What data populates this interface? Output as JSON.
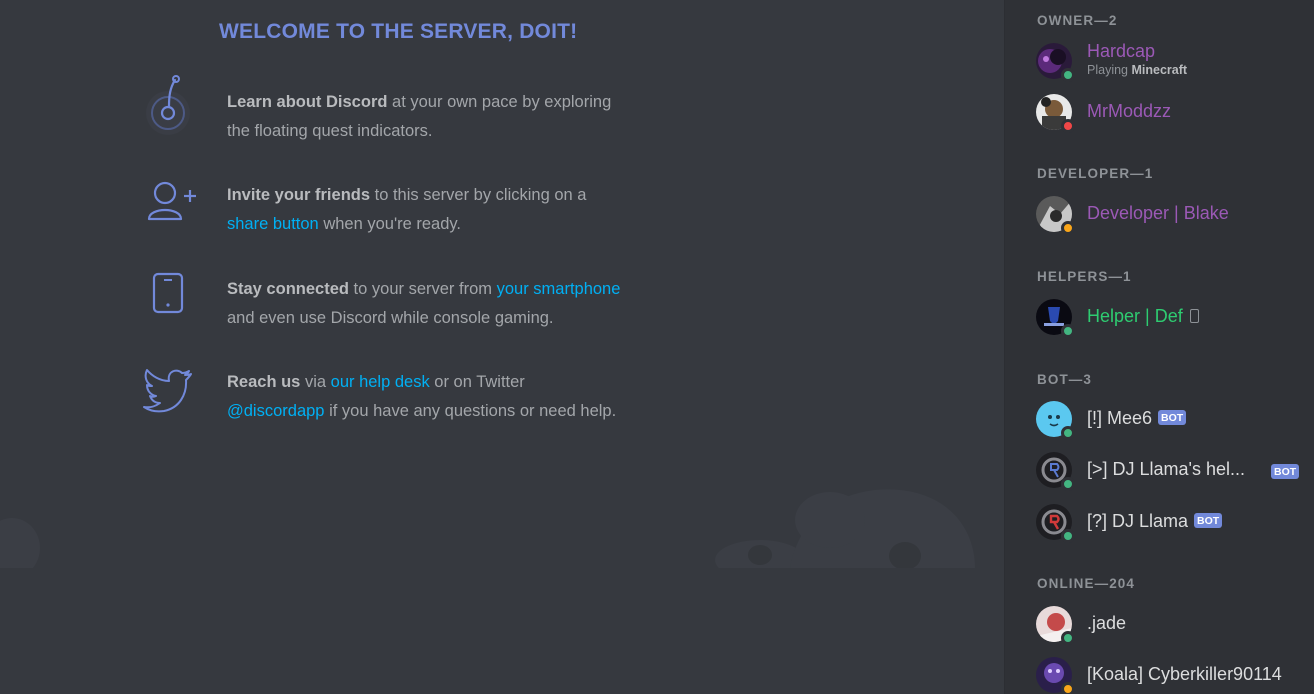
{
  "welcome": {
    "title": "WELCOME TO THE SERVER, DOIT!",
    "items": [
      {
        "icon": "quest-indicator-icon",
        "bold": "Learn about Discord",
        "t1": " at your own pace by exploring",
        "line2": "the floating quest indicators."
      },
      {
        "icon": "add-friend-icon",
        "bold": "Invite your friends",
        "t1": " to this server by clicking on a",
        "link": "share button",
        "t2": " when you're ready."
      },
      {
        "icon": "smartphone-icon",
        "bold": "Stay connected",
        "t1": " to your server from ",
        "link": "your smartphone",
        "line2": "and even use Discord while console gaming."
      },
      {
        "icon": "twitter-bird-icon",
        "bold": "Reach us",
        "t1": " via ",
        "link": "our help desk",
        "t2": " or on Twitter",
        "link2": "@discordapp",
        "t3": " if you have any questions or need help."
      }
    ]
  },
  "members": {
    "groups": [
      {
        "label": "OWNER—2"
      },
      {
        "label": "DEVELOPER—1"
      },
      {
        "label": "HELPERS—1"
      },
      {
        "label": "BOT—3"
      },
      {
        "label": "ONLINE—204"
      }
    ],
    "list": [
      {
        "name": "Hardcap",
        "color": "#9b59b6",
        "status": "online",
        "activity_prefix": "Playing ",
        "activity_game": "Minecraft"
      },
      {
        "name": "MrModdzz",
        "color": "#9b59b6",
        "status": "dnd"
      },
      {
        "name": "Developer | Blake",
        "color": "#9b59b6",
        "status": "idle"
      },
      {
        "name": "Helper | Def",
        "color": "#2ecc71",
        "status": "online"
      },
      {
        "name": "[!] Mee6",
        "color": "#dcddde",
        "status": "online",
        "badge": "BOT"
      },
      {
        "name": "[>] DJ Llama's hel...",
        "color": "#dcddde",
        "status": "online",
        "badge": "BOT"
      },
      {
        "name": "[?] DJ Llama",
        "color": "#dcddde",
        "status": "online",
        "badge": "BOT"
      },
      {
        "name": ".jade",
        "color": "#dcddde",
        "status": "online"
      },
      {
        "name": "[Koala] Cyberkiller90114",
        "color": "#dcddde",
        "status": "idle"
      }
    ],
    "status_colors": {
      "online": "#43b581",
      "idle": "#faa61a",
      "dnd": "#f04747"
    }
  }
}
